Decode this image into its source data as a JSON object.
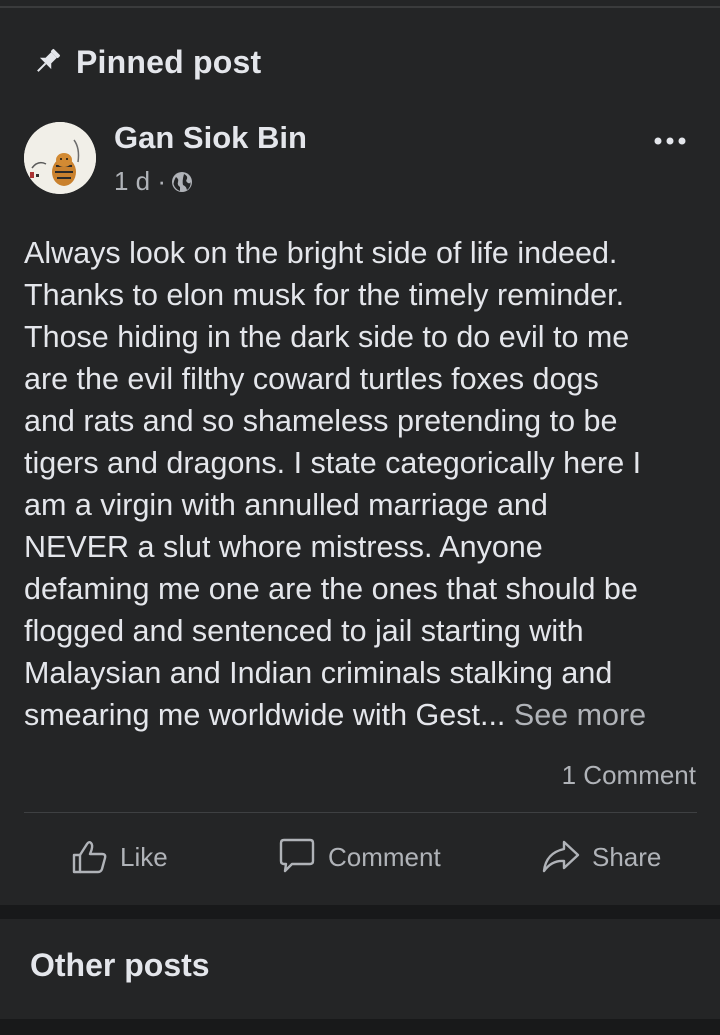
{
  "section": {
    "title": "Pinned post"
  },
  "post": {
    "author": "Gan Siok Bin",
    "time": "1 d ·",
    "body": "Always look on the bright side of life indeed.\nThanks to elon musk for the timely reminder.\nThose hiding in the dark side to do evil to me\nare the evil filthy coward turtles foxes dogs\nand rats and so shameless pretending to be\ntigers and dragons. I state categorically here I\nam a virgin with annulled marriage and\nNEVER a slut whore mistress. Anyone\ndefaming me  one are the ones that should be\nflogged and sentenced to jail starting with\nMalaysian and Indian criminals stalking and\nsmearing me worldwide with Gest... ",
    "see_more": "See more",
    "comment_count": "1 Comment"
  },
  "actions": {
    "like": "Like",
    "comment": "Comment",
    "share": "Share"
  },
  "other": {
    "title": "Other posts"
  },
  "colors": {
    "background": "#18191a",
    "card": "#242526",
    "primary_text": "#e4e6eb",
    "secondary_text": "#b0b3b8"
  }
}
